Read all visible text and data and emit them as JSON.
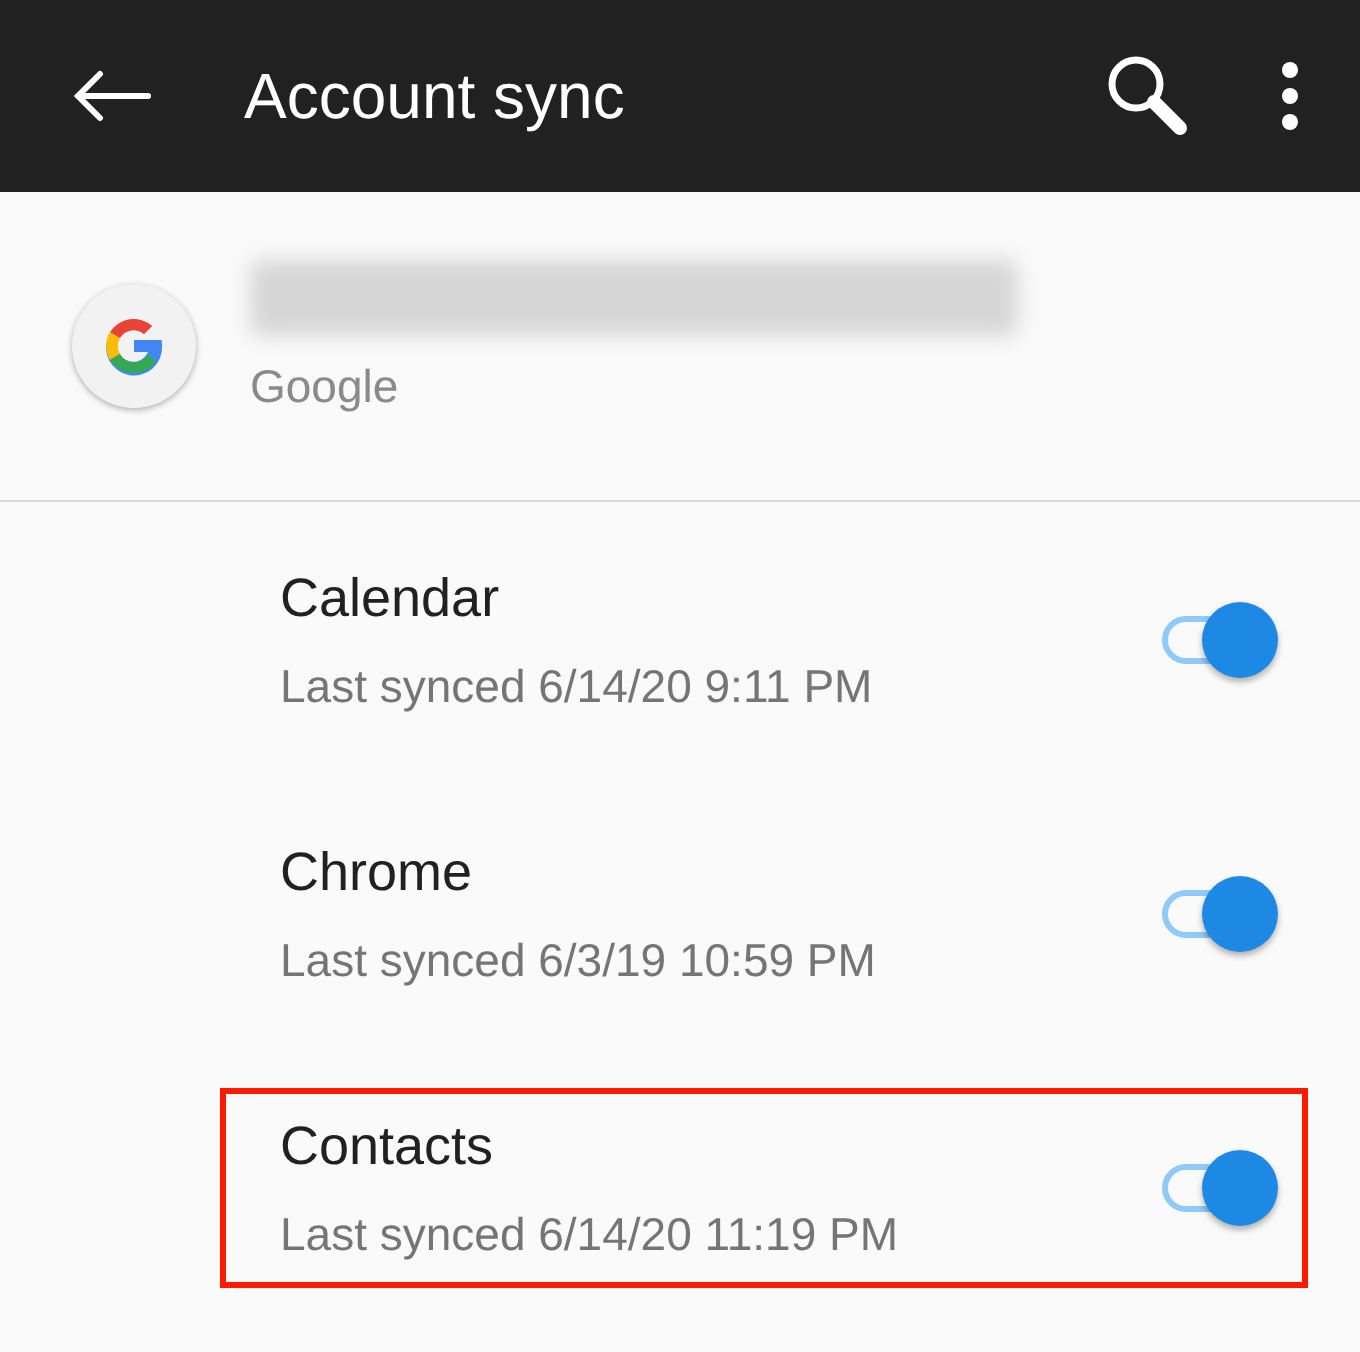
{
  "toolbar": {
    "title": "Account sync"
  },
  "account": {
    "provider": "Google"
  },
  "sync_items": [
    {
      "name": "Calendar",
      "status": "Last synced 6/14/20 9:11 PM",
      "on": true,
      "highlighted": false
    },
    {
      "name": "Chrome",
      "status": "Last synced 6/3/19 10:59 PM",
      "on": true,
      "highlighted": false
    },
    {
      "name": "Contacts",
      "status": "Last synced 6/14/20 11:19 PM",
      "on": true,
      "highlighted": true
    }
  ]
}
